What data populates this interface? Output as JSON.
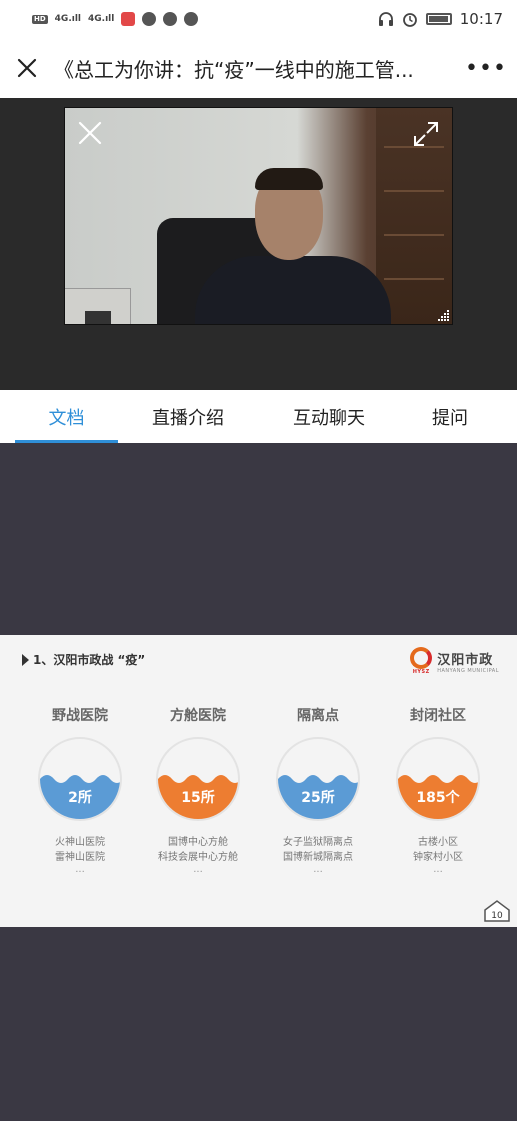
{
  "status_bar": {
    "time": "10:17",
    "left_indicators": [
      "HD",
      "4G",
      "4G"
    ],
    "icons": [
      "calendar-icon",
      "location-icon",
      "chat-bubble-icon",
      "qq-icon",
      "headphones-icon",
      "alarm-icon",
      "battery-icon"
    ]
  },
  "header": {
    "title": "《总工为你讲：抗“疫”一线中的施工管...",
    "more_label": "•••"
  },
  "tabs": [
    {
      "label": "文档",
      "active": true
    },
    {
      "label": "直播介绍",
      "active": false
    },
    {
      "label": "互动聊天",
      "active": false
    },
    {
      "label": "提问",
      "active": false
    }
  ],
  "slide": {
    "title": "1、汉阳市政战 “疫”",
    "brand_name": "汉阳市政",
    "brand_sub": "HANYANG MUNICIPAL",
    "brand_mark": "HYSZ",
    "page_number": "10",
    "columns": [
      {
        "title": "野战医院",
        "value": "2所",
        "color": "#5b9bd5",
        "items": [
          "火神山医院",
          "雷神山医院"
        ],
        "more": "..."
      },
      {
        "title": "方舱医院",
        "value": "15所",
        "color": "#ed7d31",
        "items": [
          "国博中心方舱",
          "科技会展中心方舱"
        ],
        "more": "..."
      },
      {
        "title": "隔离点",
        "value": "25所",
        "color": "#5b9bd5",
        "items": [
          "女子监狱隔离点",
          "国博新城隔离点"
        ],
        "more": "..."
      },
      {
        "title": "封闭社区",
        "value": "185个",
        "color": "#ed7d31",
        "items": [
          "古楼小区",
          "钟家村小区"
        ],
        "more": "..."
      }
    ]
  }
}
